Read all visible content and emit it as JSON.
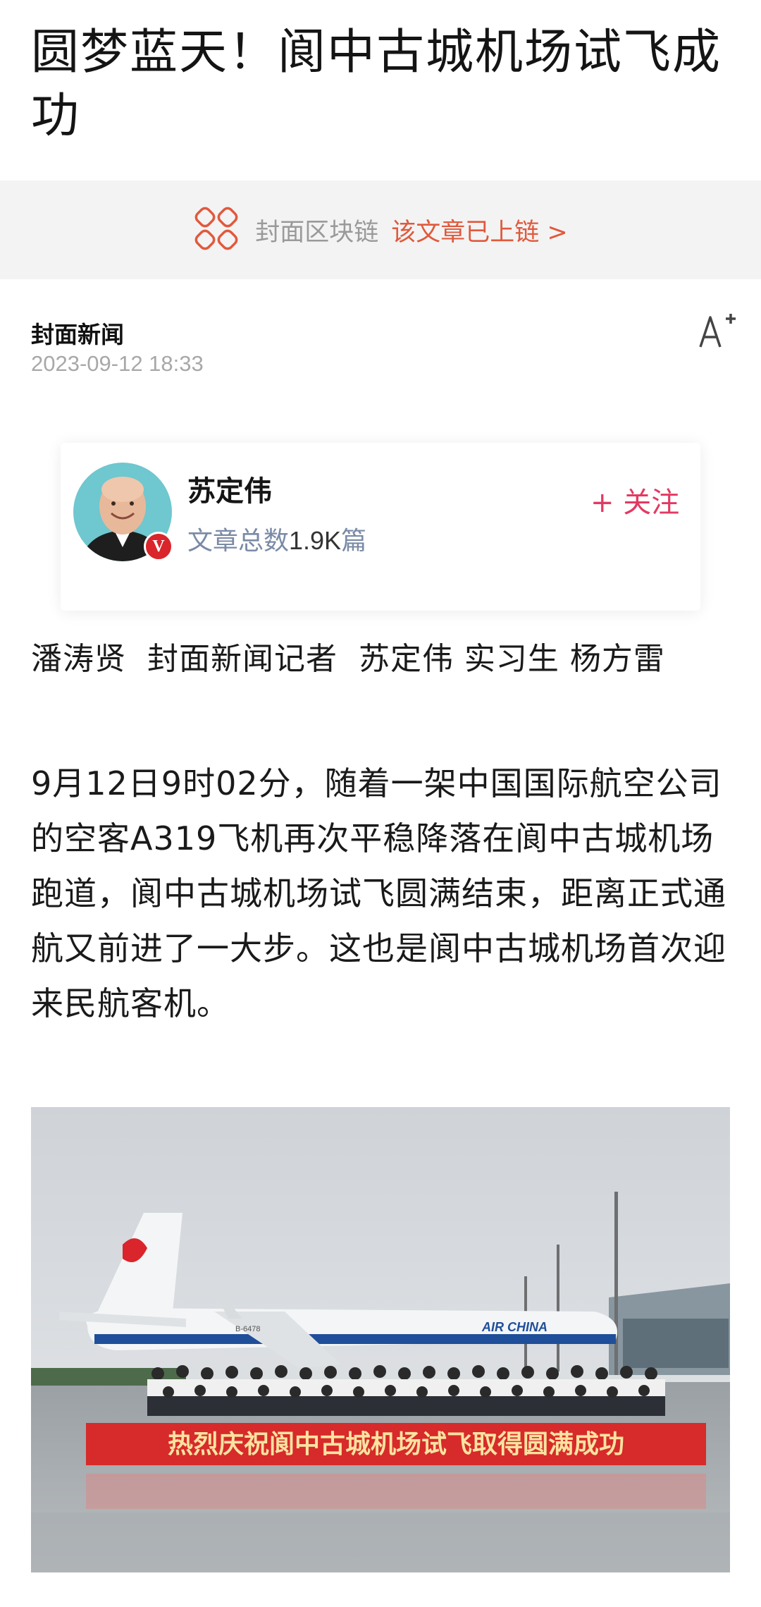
{
  "article": {
    "title": "圆梦蓝天！阆中古城机场试飞成功",
    "chain_text": "封面区块链",
    "chain_link": "该文章已上链 >",
    "source": "封面新闻",
    "date": "2023-09-12 18:33",
    "font_size_icon": "font-size-icon"
  },
  "author": {
    "name": "苏定伟",
    "count_label": "文章总数",
    "count_value": "1.9K",
    "count_unit": "篇",
    "badge": "V",
    "follow_label": "+ 关注"
  },
  "byline": "潘涛贤  封面新闻记者  苏定伟 实习生 杨方雷",
  "paragraph": "9月12日9时02分，随着一架中国国际航空公司的空客A319飞机再次平稳降落在阆中古城机场跑道，阆中古城机场试飞圆满结束，距离正式通航又前进了一大步。这也是阆中古城机场首次迎来民航客机。",
  "photo": {
    "banner_text": "热烈庆祝阆中古城机场试飞取得圆满成功",
    "airline_text": "AIR CHINA",
    "registration": "B-6478"
  },
  "colors": {
    "accent_red": "#e0593d",
    "follow_pink": "#e23a62",
    "count_blue": "#7a8aa6",
    "banner_bg": "#f3f3f3"
  }
}
